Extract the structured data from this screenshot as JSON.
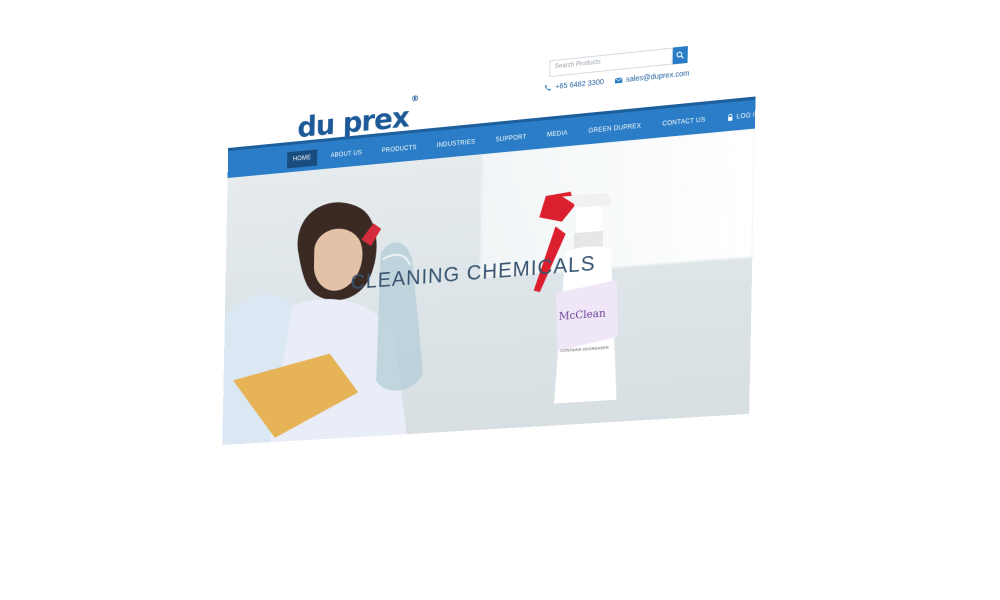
{
  "header": {
    "search_placeholder": "Search Products",
    "phone": "+65 6482 3300",
    "email": "sales@duprex.com",
    "logo_text": "du prex",
    "logo_mark": "®"
  },
  "nav": {
    "items": [
      {
        "label": "HOME"
      },
      {
        "label": "ABOUT US"
      },
      {
        "label": "PRODUCTS"
      },
      {
        "label": "INDUSTRIES"
      },
      {
        "label": "SUPPORT"
      },
      {
        "label": "MEDIA"
      },
      {
        "label": "GREEN DUPREX"
      },
      {
        "label": "CONTACT US"
      }
    ],
    "login_label": "LOG IN",
    "active": "HOME"
  },
  "hero": {
    "headline": "CLEANING CHEMICALS",
    "product_brand": "McClean",
    "product_subtext": "CONTAINS DEGREASER"
  },
  "colors": {
    "brand_blue": "#2a7dc6",
    "brand_dark": "#1d5a97",
    "active_nav": "#194d80"
  }
}
